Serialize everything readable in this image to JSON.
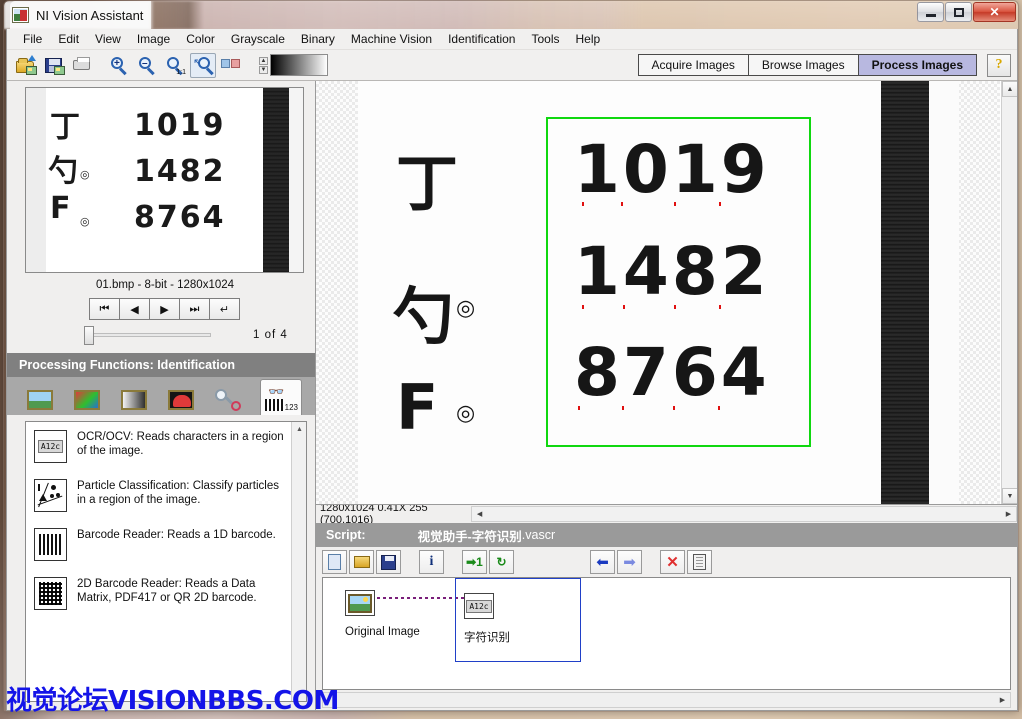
{
  "window": {
    "title": "NI Vision Assistant",
    "controls": {
      "minimize": "–",
      "restore": "❐",
      "close": "✕"
    }
  },
  "menubar": {
    "items": [
      "File",
      "Edit",
      "View",
      "Image",
      "Color",
      "Grayscale",
      "Binary",
      "Machine Vision",
      "Identification",
      "Tools",
      "Help"
    ]
  },
  "toolbar": {
    "buttons": [
      {
        "name": "open-image-icon",
        "title": "Open Image"
      },
      {
        "name": "save-image-icon",
        "title": "Save Image"
      },
      {
        "name": "print-icon",
        "title": "Print"
      },
      {
        "name": "zoom-in-icon",
        "title": "Zoom In"
      },
      {
        "name": "zoom-out-icon",
        "title": "Zoom Out"
      },
      {
        "name": "zoom-actual-icon",
        "title": "Zoom 1:1"
      },
      {
        "name": "zoom-fit-icon",
        "title": "Zoom To Fit"
      },
      {
        "name": "image-pair-icon",
        "title": "Compare Images"
      }
    ],
    "zoom_ratio_label": "1:1",
    "tabs": [
      {
        "label": "Acquire Images",
        "active": false
      },
      {
        "label": "Browse Images",
        "active": false
      },
      {
        "label": "Process Images",
        "active": true
      }
    ],
    "help_label": "?"
  },
  "browser": {
    "caption": "01.bmp - 8-bit - 1280x1024",
    "nav": [
      {
        "name": "first-image-button",
        "glyph": "⏮"
      },
      {
        "name": "previous-image-button",
        "glyph": "◀"
      },
      {
        "name": "next-image-button",
        "glyph": "▶"
      },
      {
        "name": "last-image-button",
        "glyph": "⏭"
      },
      {
        "name": "reload-image-button",
        "glyph": "↵"
      }
    ],
    "page_indicator": "1  of  4",
    "thumbnail": {
      "numbers": [
        "1019",
        "1482",
        "8764"
      ],
      "side_chars": [
        "丁",
        "勺",
        "F"
      ],
      "degree_marks": [
        "◎",
        "◎"
      ]
    }
  },
  "processing_functions": {
    "header": "Processing Functions: Identification",
    "categories": [
      {
        "name": "category-image",
        "label": "Image",
        "selected": false
      },
      {
        "name": "category-color",
        "label": "Color",
        "selected": false
      },
      {
        "name": "category-grayscale",
        "label": "Grayscale",
        "selected": false
      },
      {
        "name": "category-binary",
        "label": "Binary",
        "selected": false
      },
      {
        "name": "category-machine-vision",
        "label": "Machine Vision",
        "selected": false
      },
      {
        "name": "category-identification",
        "label": "Identification",
        "selected": true
      }
    ],
    "identification_badge": "123",
    "functions": [
      {
        "icon": "ocr-icon",
        "icon_text": "A12c",
        "title": "OCR/OCV:",
        "desc": "Reads characters in a region of the image."
      },
      {
        "icon": "particle-classification-icon",
        "icon_text": "",
        "title": "Particle Classification:",
        "desc": "Classify particles in a region of the image."
      },
      {
        "icon": "barcode-icon",
        "icon_text": "",
        "title": "Barcode Reader:",
        "desc": "Reads a 1D barcode."
      },
      {
        "icon": "datamatrix-icon",
        "icon_text": "",
        "title": "2D Barcode Reader:",
        "desc": "Reads a Data Matrix, PDF417 or QR 2D barcode."
      }
    ]
  },
  "canvas": {
    "roi_color": "#10d810",
    "numbers": [
      "1019",
      "1482",
      "8764"
    ],
    "side_chars": [
      "丁",
      "勺",
      "F"
    ],
    "degree_marks": [
      "◎",
      "◎"
    ]
  },
  "statusbar": {
    "resolution": "1280x1024",
    "zoom": "0.41X",
    "intensity": "255",
    "coordinates": "(700,1016)",
    "text": "1280x1024 0.41X 255   (700,1016)"
  },
  "script": {
    "label": "Script:",
    "name": "视觉助手-字符识别",
    "extension": ".vascr",
    "tools": [
      {
        "name": "new-script-button",
        "glyph": ""
      },
      {
        "name": "open-script-button",
        "glyph": ""
      },
      {
        "name": "save-script-button",
        "glyph": ""
      },
      {
        "name": "script-info-button",
        "glyph": "i"
      },
      {
        "name": "run-once-button",
        "glyph": "➡1"
      },
      {
        "name": "run-continuous-button",
        "glyph": "↻"
      },
      {
        "name": "step-back-button",
        "glyph": "⬅"
      },
      {
        "name": "step-forward-button",
        "glyph": "➡"
      },
      {
        "name": "delete-step-button",
        "glyph": "✕"
      },
      {
        "name": "copy-step-button",
        "glyph": ""
      }
    ],
    "steps": [
      {
        "label": "Original Image",
        "icon": "image-step-icon",
        "selected": false
      },
      {
        "label": "字符识别",
        "icon": "ocr-step-icon",
        "icon_text": "A12c",
        "selected": true
      }
    ]
  },
  "watermark": {
    "text": "视觉论坛VISIONBBS.COM",
    "color": "#1414e8"
  }
}
